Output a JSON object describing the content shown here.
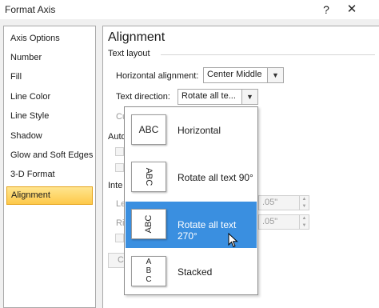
{
  "window": {
    "title": "Format Axis",
    "help": "?",
    "close": "✕"
  },
  "nav": {
    "items": [
      {
        "label": "Axis Options"
      },
      {
        "label": "Number"
      },
      {
        "label": "Fill"
      },
      {
        "label": "Line Color"
      },
      {
        "label": "Line Style"
      },
      {
        "label": "Shadow"
      },
      {
        "label": "Glow and Soft Edges"
      },
      {
        "label": "3-D Format"
      },
      {
        "label": "Alignment"
      }
    ],
    "selected_index": 8
  },
  "panel": {
    "title": "Alignment",
    "text_layout_label": "Text layout",
    "horizontal_alignment": {
      "label": "Horizontal alignment:",
      "value": "Center Middle"
    },
    "text_direction": {
      "label": "Text direction:",
      "value": "Rotate all te..."
    },
    "custom_angle_partial": "Cu",
    "autofit_partial": "Auto",
    "internal_margin_partial": "Inte",
    "left_partial": "Le",
    "right_partial": "Ri",
    "left_value_partial": ".05\"",
    "right_value_partial": ".05\"",
    "button_partial": "C"
  },
  "dropdown": {
    "items": [
      {
        "label": "Horizontal",
        "icon_text": "ABC",
        "icon": "text-horizontal-icon"
      },
      {
        "label": "Rotate all text 90°",
        "icon_text": "ABC",
        "icon": "text-rotate-90-icon"
      },
      {
        "label": "Rotate all text 270°",
        "icon_text": "ABC",
        "icon": "text-rotate-270-icon"
      },
      {
        "label": "Stacked",
        "icon_text": "ABC",
        "icon": "text-stacked-icon"
      }
    ],
    "selected_index": 2
  },
  "colors": {
    "selection_blue": "#3a8fe0",
    "nav_selected": "#fdc94a"
  }
}
